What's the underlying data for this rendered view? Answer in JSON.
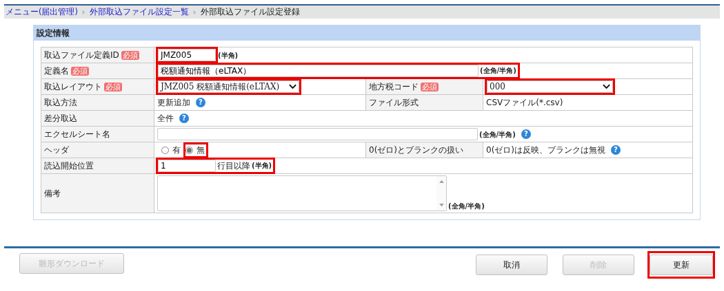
{
  "breadcrumb": [
    {
      "label": "メニュー(届出管理)",
      "link": true
    },
    {
      "label": "外部取込ファイル設定一覧",
      "link": true
    },
    {
      "label": "外部取込ファイル設定登録",
      "link": false
    }
  ],
  "panel": {
    "title": "設定情報",
    "rows": [
      {
        "fields": [
          {
            "label": "取込ファイル定義ID",
            "badge": "必須",
            "control": {
              "kind": "input",
              "value": "JMZ005",
              "wide": false,
              "note": "(半角)",
              "highlighted": true,
              "note_highlighted": false
            }
          }
        ]
      },
      {
        "fields": [
          {
            "label": "定義名",
            "badge": "必須",
            "control": {
              "kind": "input",
              "value": "税額通知情報（eLTAX）",
              "wide": true,
              "note": "(全角/半角)",
              "highlighted": true,
              "note_highlighted": true
            }
          }
        ]
      },
      {
        "fields": [
          {
            "label": "取込レイアウト",
            "badge": "必須",
            "control": {
              "kind": "select",
              "value": "JMZ005 税額通知情報(eLTAX)",
              "highlighted": true
            }
          },
          {
            "label": "地方税コード",
            "badge": "必須",
            "control": {
              "kind": "select",
              "value": "000",
              "highlighted": true
            }
          }
        ]
      },
      {
        "fields": [
          {
            "label": "取込方法",
            "control": {
              "kind": "text",
              "value": "更新追加",
              "help": "?"
            }
          },
          {
            "label": "ファイル形式",
            "control": {
              "kind": "text",
              "value": "CSVファイル(*.csv)"
            }
          }
        ]
      },
      {
        "fields": [
          {
            "label": "差分取込",
            "control": {
              "kind": "text",
              "value": "全件",
              "help": "?"
            }
          }
        ]
      },
      {
        "fields": [
          {
            "label": "エクセルシート名",
            "control": {
              "kind": "input",
              "wide": true,
              "note": "(全角/半角)",
              "help": "?",
              "highlighted": false
            }
          }
        ]
      },
      {
        "fields": [
          {
            "label": "ヘッダ",
            "control": {
              "kind": "radio",
              "options": [
                {
                  "label": "有",
                  "selected": false,
                  "highlighted": false
                },
                {
                  "label": "無",
                  "selected": true,
                  "highlighted": true
                }
              ]
            }
          },
          {
            "label": "0(ゼロ)とブランクの扱い",
            "control": {
              "kind": "text",
              "value": "0(ゼロ)は反映、ブランクは無視",
              "help": "?"
            }
          }
        ]
      },
      {
        "fields": [
          {
            "label": "読込開始位置",
            "control": {
              "kind": "input",
              "value": "1",
              "wide": false,
              "suffix": "行目以降",
              "note": "(半角)",
              "highlighted": true,
              "note_highlighted": true
            }
          }
        ]
      },
      {
        "fields": [
          {
            "label": "備考",
            "control": {
              "kind": "textarea",
              "note": "(全角/半角)"
            }
          }
        ]
      }
    ]
  },
  "footer": {
    "left_buttons": [
      {
        "label": "雛形ダウンロード",
        "disabled": true,
        "highlighted": false
      }
    ],
    "right_buttons": [
      {
        "label": "取消",
        "disabled": false,
        "highlighted": false
      },
      {
        "label": "削除",
        "disabled": true,
        "highlighted": false
      },
      {
        "label": "更新",
        "disabled": false,
        "highlighted": true
      }
    ]
  }
}
